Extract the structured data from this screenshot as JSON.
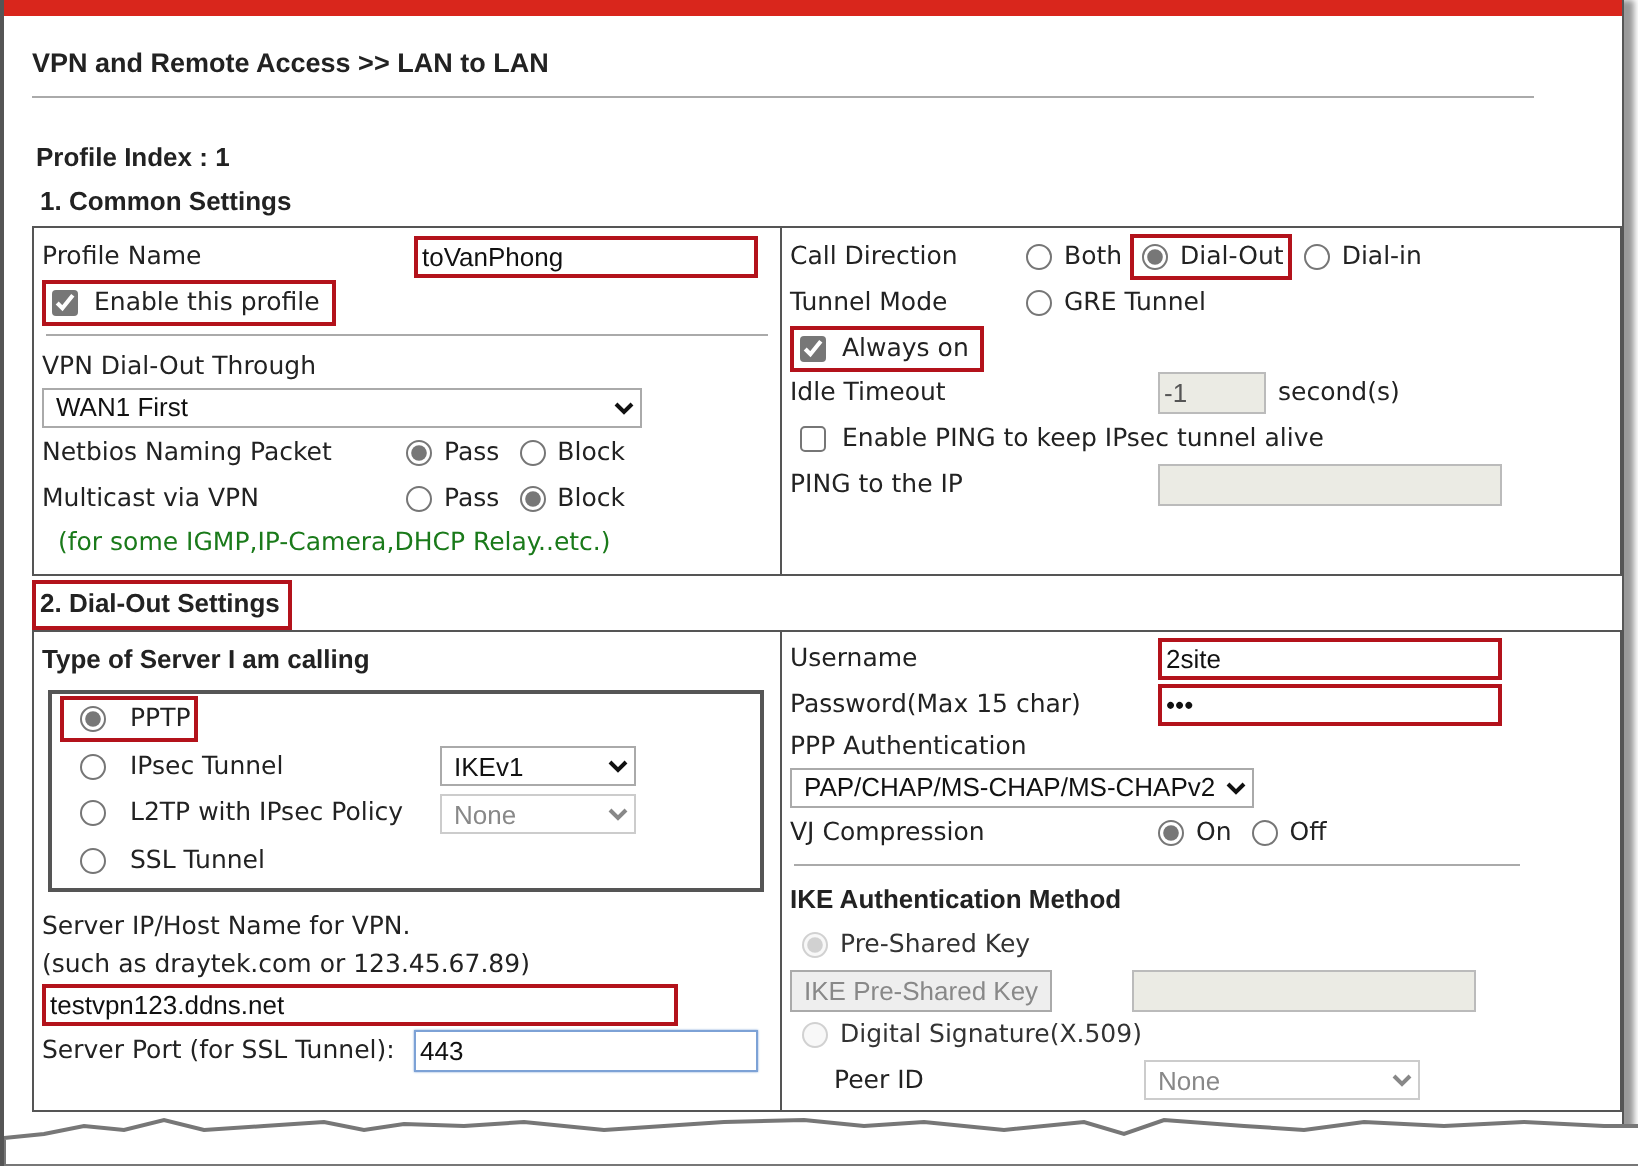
{
  "page_title": "VPN and Remote Access >> LAN to LAN",
  "profile_index": "Profile Index : 1",
  "sections": [
    {
      "heading": "1. Common Settings",
      "highlighted": false,
      "left": [
        {
          "kind": "field",
          "label": "Profile Name",
          "value": "toVanPhong",
          "highlighted": true,
          "disabled": false,
          "focused": false
        },
        {
          "kind": "checkbox",
          "label": "Enable this profile",
          "checked": true,
          "highlighted": true
        },
        {
          "kind": "divider"
        },
        {
          "kind": "label",
          "text": "VPN Dial-Out Through"
        },
        {
          "kind": "select",
          "value": "WAN1 First",
          "disabled": false
        },
        {
          "kind": "radios",
          "label": "Netbios Naming Packet",
          "options": [
            {
              "label": "Pass",
              "selected": true,
              "highlighted": false
            },
            {
              "label": "Block",
              "selected": false,
              "highlighted": false
            }
          ]
        },
        {
          "kind": "radios",
          "label": "Multicast via VPN",
          "options": [
            {
              "label": "Pass",
              "selected": false,
              "highlighted": false
            },
            {
              "label": "Block",
              "selected": true,
              "highlighted": false
            }
          ]
        },
        {
          "kind": "note",
          "text": "(for some IGMP,IP-Camera,DHCP Relay..etc.)"
        }
      ],
      "right": [
        {
          "kind": "radios",
          "label": "Call Direction",
          "options": [
            {
              "label": "Both",
              "selected": false,
              "highlighted": false
            },
            {
              "label": "Dial-Out",
              "selected": true,
              "highlighted": true
            },
            {
              "label": "Dial-in",
              "selected": false,
              "highlighted": false
            }
          ]
        },
        {
          "kind": "radios",
          "label": "Tunnel Mode",
          "options": [
            {
              "label": "GRE Tunnel",
              "selected": false,
              "highlighted": false
            }
          ]
        },
        {
          "kind": "checkbox",
          "label": "Always on",
          "checked": true,
          "highlighted": true
        },
        {
          "kind": "field",
          "label": "Idle Timeout",
          "value": "-1",
          "unit": "second(s)",
          "highlighted": false,
          "disabled": true,
          "focused": false
        },
        {
          "kind": "checkbox",
          "label": "Enable PING to keep IPsec tunnel alive",
          "checked": false,
          "highlighted": false
        },
        {
          "kind": "field",
          "label": "PING to the IP",
          "highlighted": false,
          "disabled": true,
          "focused": false
        }
      ]
    },
    {
      "heading": "2. Dial-Out Settings",
      "highlighted": true,
      "left": [
        {
          "kind": "heading",
          "text": "Type of Server I am calling"
        },
        {
          "kind": "option-group",
          "options": [
            {
              "label": "PPTP",
              "selected": true,
              "highlighted": true
            },
            {
              "label": "IPsec Tunnel",
              "selected": false,
              "highlighted": false,
              "select": {
                "value": "IKEv1",
                "disabled": false
              }
            },
            {
              "label": "L2TP with IPsec Policy",
              "selected": false,
              "highlighted": false,
              "select": {
                "value": "None",
                "disabled": true
              }
            },
            {
              "label": "SSL Tunnel",
              "selected": false,
              "highlighted": false
            }
          ]
        },
        {
          "kind": "label",
          "text": "Server IP/Host Name for VPN."
        },
        {
          "kind": "label",
          "text": "(such as draytek.com or 123.45.67.89)"
        },
        {
          "kind": "field",
          "value": "testvpn123.ddns.net",
          "highlighted": true,
          "disabled": false,
          "focused": false
        },
        {
          "kind": "field",
          "label": "Server Port (for SSL Tunnel):",
          "value": "443",
          "highlighted": false,
          "disabled": false,
          "focused": true
        }
      ],
      "right": [
        {
          "kind": "field",
          "label": "Username",
          "value": "2site",
          "highlighted": true,
          "disabled": false,
          "focused": false
        },
        {
          "kind": "field",
          "label": "Password(Max 15 char)",
          "value": "•••",
          "highlighted": true,
          "disabled": false,
          "focused": false
        },
        {
          "kind": "label",
          "text": "PPP Authentication"
        },
        {
          "kind": "select",
          "value": "PAP/CHAP/MS-CHAP/MS-CHAPv2",
          "disabled": false
        },
        {
          "kind": "radios",
          "label": "VJ Compression",
          "options": [
            {
              "label": "On",
              "selected": true,
              "highlighted": false
            },
            {
              "label": "Off",
              "selected": false,
              "highlighted": false
            }
          ]
        },
        {
          "kind": "divider"
        },
        {
          "kind": "heading",
          "text": "IKE Authentication Method"
        },
        {
          "kind": "radio",
          "label": "Pre-Shared Key",
          "selected": true,
          "disabled": true
        },
        {
          "kind": "button-field",
          "label": "IKE Pre-Shared Key",
          "disabled": true
        },
        {
          "kind": "radio",
          "label": "Digital Signature(X.509)",
          "selected": false,
          "disabled": true
        },
        {
          "kind": "sub-select",
          "label": "Peer ID",
          "value": "None",
          "disabled": true
        }
      ]
    }
  ]
}
